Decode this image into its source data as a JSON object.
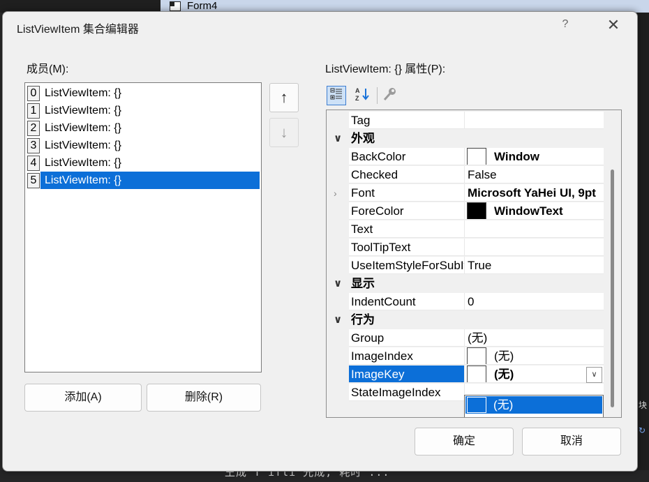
{
  "background": {
    "form_title": "Form4",
    "bottom_text": "王成 T ifli 光成, 耗时 ...",
    "right_glyph1": "块",
    "right_glyph2": "↻"
  },
  "dialog": {
    "title": "ListViewItem 集合编辑器",
    "help_label": "?",
    "close_label": "✕",
    "members_label": "成员(M):",
    "properties_label": "ListViewItem: {} 属性(P):",
    "up_label": "↑",
    "down_label": "↓",
    "add_label": "添加(A)",
    "remove_label": "删除(R)",
    "ok_label": "确定",
    "cancel_label": "取消"
  },
  "members": [
    {
      "index": "0",
      "text": "ListViewItem: {}"
    },
    {
      "index": "1",
      "text": "ListViewItem: {}"
    },
    {
      "index": "2",
      "text": "ListViewItem: {}"
    },
    {
      "index": "3",
      "text": "ListViewItem: {}"
    },
    {
      "index": "4",
      "text": "ListViewItem: {}"
    },
    {
      "index": "5",
      "text": "ListViewItem: {}"
    }
  ],
  "selected_member_index": 5,
  "toolbar": {
    "categorized_icon": "categorized-icon",
    "alphabetical_icon": "alphabetical-sort-icon",
    "pages_icon": "wrench-icon"
  },
  "properties": {
    "tag": {
      "name": "Tag",
      "value": ""
    },
    "cat_appearance": "外观",
    "backcolor": {
      "name": "BackColor",
      "value": "Window"
    },
    "checked": {
      "name": "Checked",
      "value": "False"
    },
    "font": {
      "name": "Font",
      "value": "Microsoft YaHei UI, 9pt"
    },
    "forecolor": {
      "name": "ForeColor",
      "value": "WindowText"
    },
    "text": {
      "name": "Text",
      "value": ""
    },
    "tooltiptext": {
      "name": "ToolTipText",
      "value": ""
    },
    "useitemstyle": {
      "name": "UseItemStyleForSubItems",
      "value": "True"
    },
    "cat_display": "显示",
    "indentcount": {
      "name": "IndentCount",
      "value": "0"
    },
    "cat_behavior": "行为",
    "group": {
      "name": "Group",
      "value": "(无)"
    },
    "imageindex": {
      "name": "ImageIndex",
      "value": "(无)"
    },
    "imagekey": {
      "name": "ImageKey",
      "value": "(无)"
    },
    "stateimageindex": {
      "name": "StateImageIndex",
      "value": ""
    },
    "popup_option": "(无)"
  },
  "colors": {
    "selection": "#0c6fd8",
    "dialog_bg": "#f0f0f0"
  }
}
